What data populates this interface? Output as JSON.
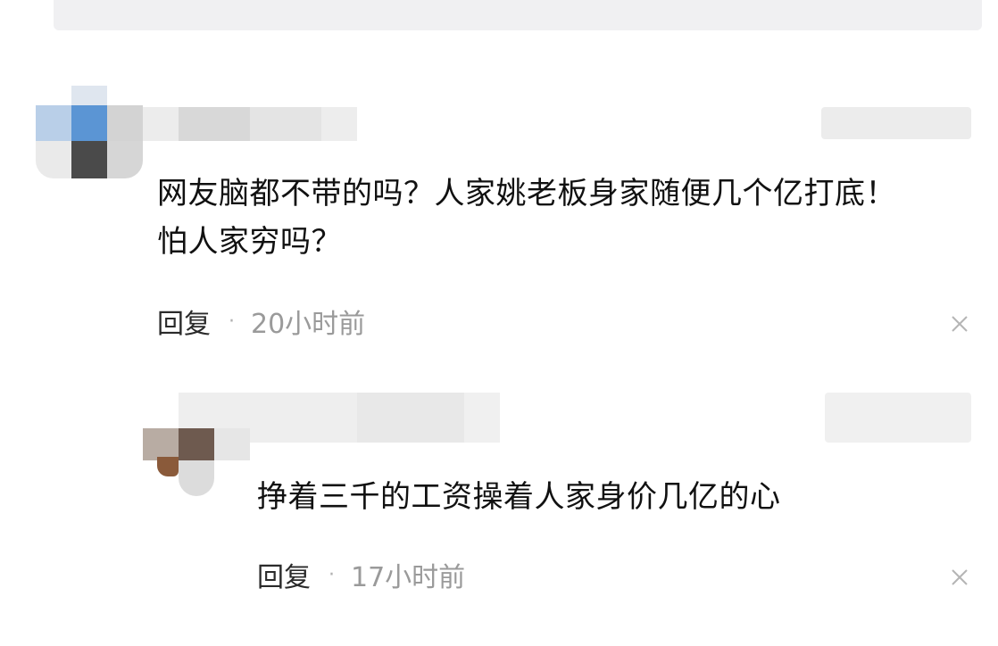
{
  "comments": [
    {
      "text": "网友脑都不带的吗？人家姚老板身家随便几个亿打底！怕人家穷吗？",
      "reply_label": "回复",
      "separator": "·",
      "time": "20小时前",
      "close_icon": "close-icon"
    },
    {
      "text": "挣着三千的工资操着人家身价几亿的心",
      "reply_label": "回复",
      "separator": "·",
      "time": "17小时前",
      "close_icon": "close-icon"
    }
  ]
}
